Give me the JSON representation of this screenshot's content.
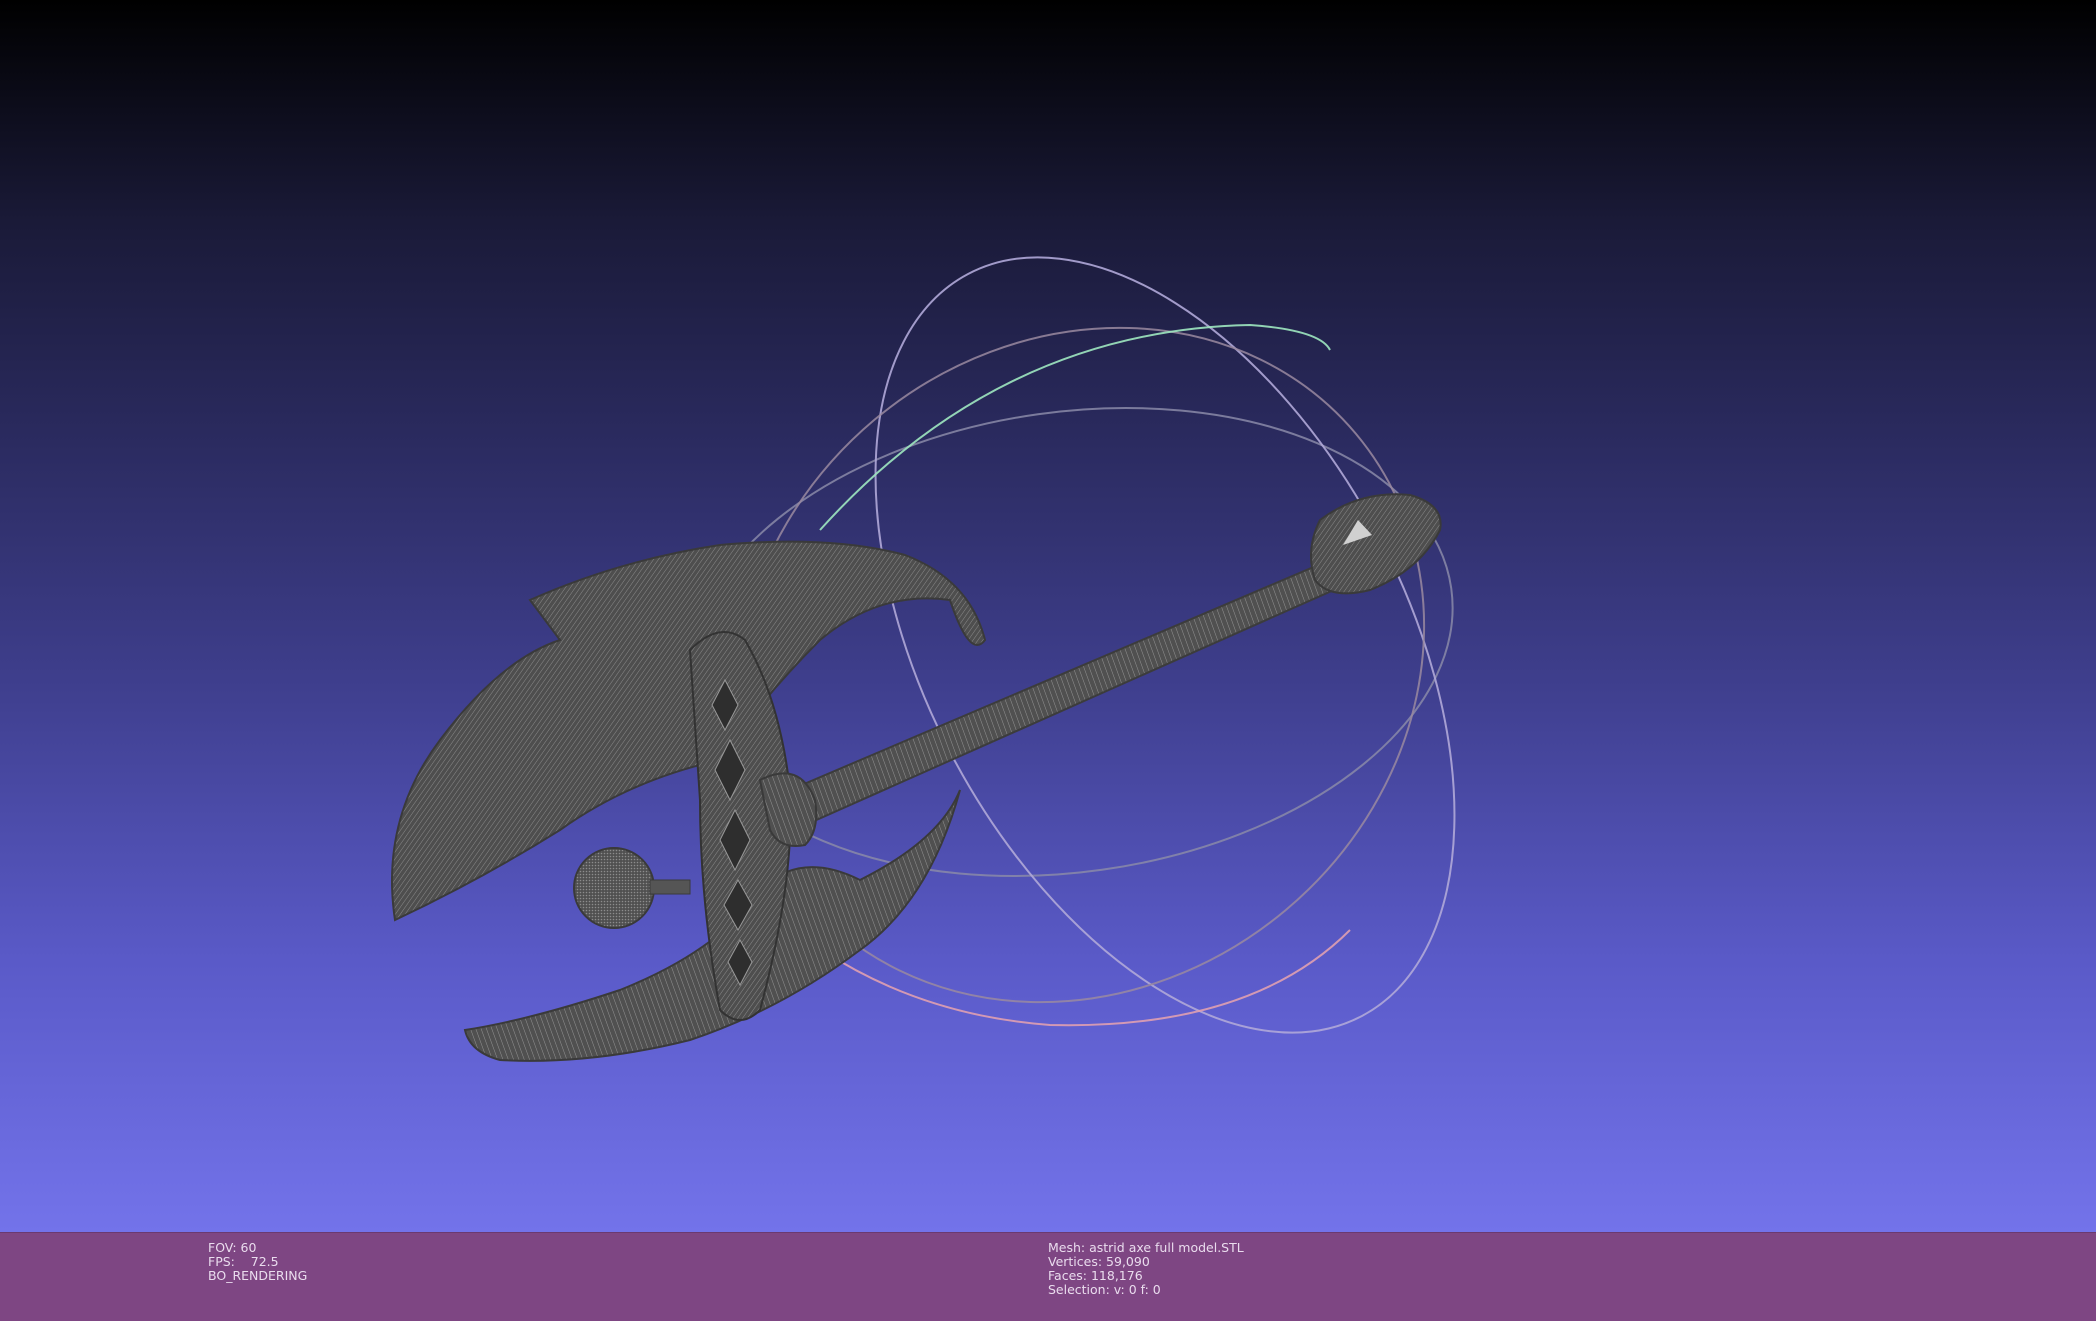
{
  "viewer": {
    "fov_line": "FOV: 60",
    "fps_line": "FPS:    72.5",
    "render_mode": "BO_RENDERING"
  },
  "mesh": {
    "name_line": "Mesh: astrid axe full model.STL",
    "vertices_line": "Vertices: 59,090",
    "faces_line": "Faces: 118,176",
    "selection_line": "Selection: v: 0 f: 0"
  },
  "colors": {
    "background_top": "#000000",
    "background_bottom": "#7373ea",
    "status_bar": "#7e4683",
    "mesh": "#555555",
    "trackball_x": "#e08080",
    "trackball_y": "#80e0b0",
    "trackball_z": "#a090e0"
  },
  "icons": {
    "trackball": "trackball-gizmo",
    "model": "axe-mesh"
  }
}
